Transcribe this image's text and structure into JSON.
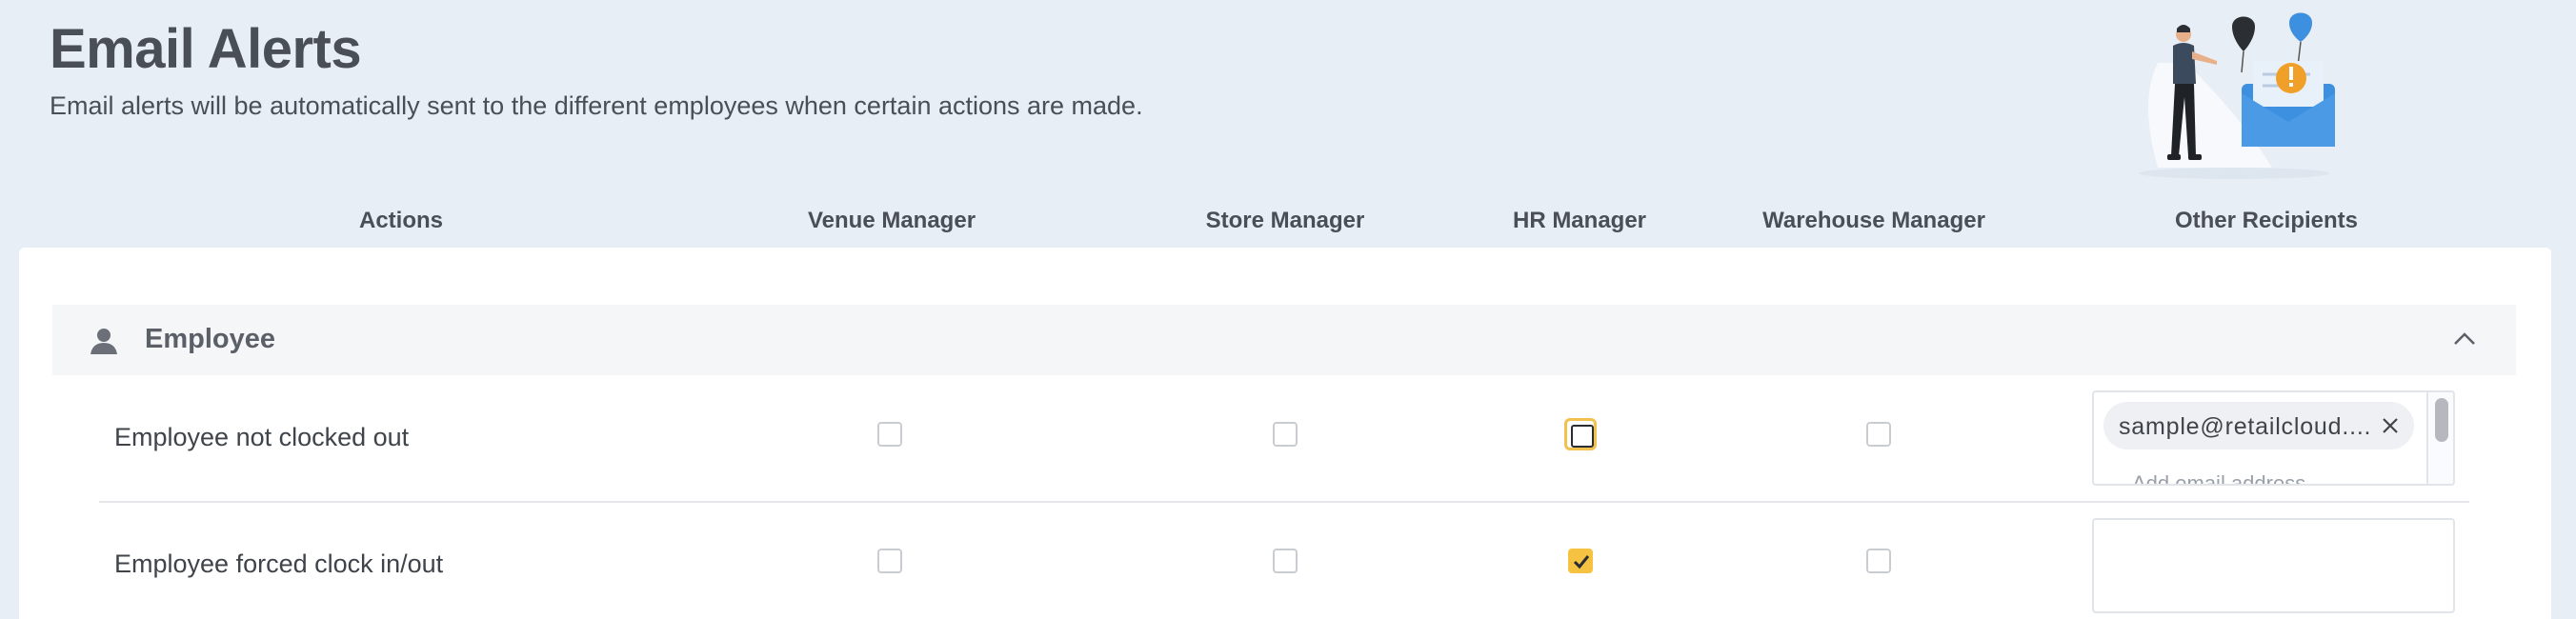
{
  "header": {
    "title": "Email Alerts",
    "subtitle": "Email alerts will be automatically sent to the different employees when certain actions are made."
  },
  "columns": {
    "actions": "Actions",
    "venue_manager": "Venue Manager",
    "store_manager": "Store Manager",
    "hr_manager": "HR Manager",
    "warehouse_manager": "Warehouse Manager",
    "other_recipients": "Other Recipients"
  },
  "section": {
    "label": "Employee",
    "icon": "person-icon",
    "toggle_icon": "chevron-up-icon",
    "expanded": true
  },
  "rows": [
    {
      "label": "Employee not clocked out",
      "venue_manager": false,
      "store_manager": false,
      "hr_manager": false,
      "warehouse_manager": false,
      "recipients": [
        "sample@retailcloud...."
      ],
      "input_placeholder": "Add email address"
    },
    {
      "label": "Employee forced clock in/out",
      "venue_manager": false,
      "store_manager": false,
      "hr_manager": true,
      "warehouse_manager": false,
      "recipients": []
    }
  ],
  "colors": {
    "background": "#e8eef5",
    "accent": "#f5c242",
    "card": "#ffffff",
    "section_bg": "#f5f6f8"
  }
}
